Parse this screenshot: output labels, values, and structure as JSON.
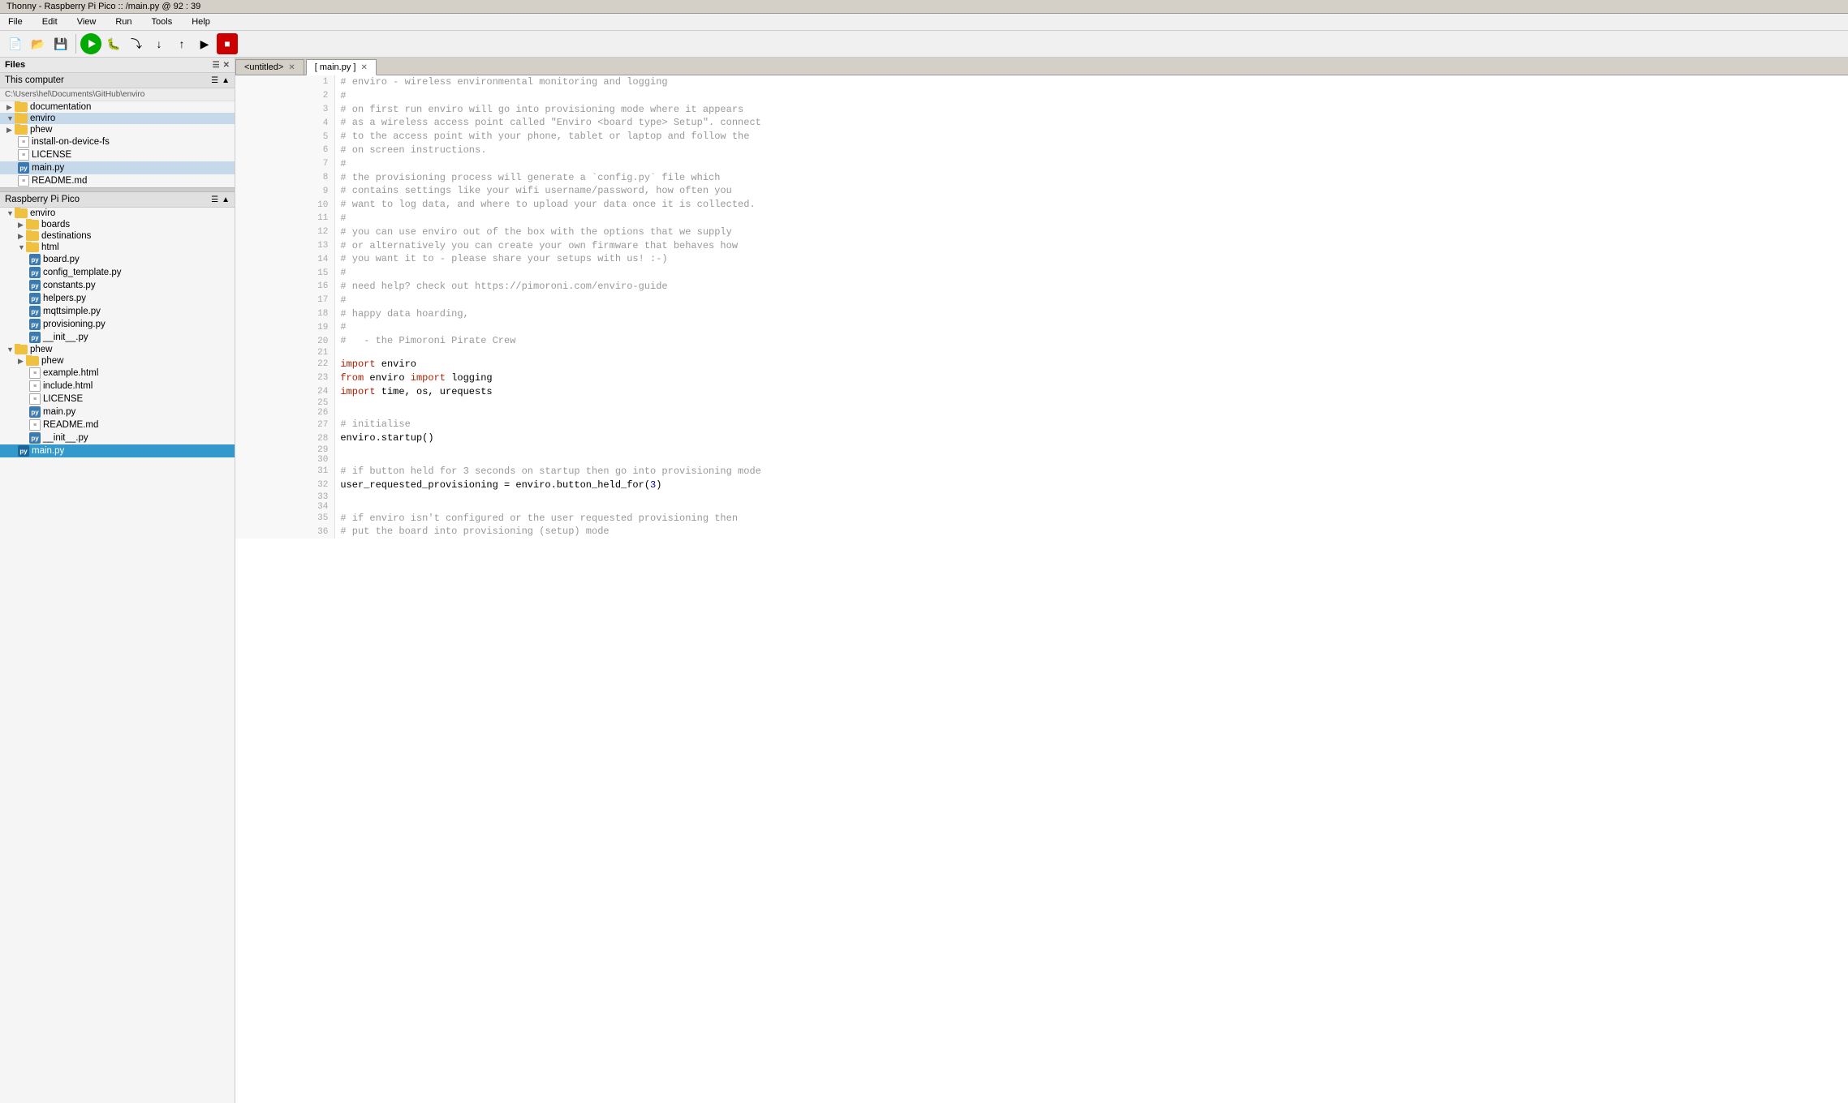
{
  "window": {
    "title": "Thonny - Raspberry Pi Pico :: /main.py @ 92 : 39"
  },
  "menu": {
    "items": [
      "File",
      "Edit",
      "View",
      "Run",
      "Tools",
      "Help"
    ]
  },
  "toolbar": {
    "buttons": [
      "new",
      "open",
      "save",
      "run",
      "debug",
      "step-over",
      "step-into",
      "step-out",
      "resume",
      "stop"
    ]
  },
  "files_panel": {
    "title": "Files",
    "this_computer": {
      "label": "This computer",
      "path": "C:\\Users\\hel\\Documents\\GitHub\\enviro"
    },
    "pi_pico": {
      "label": "Raspberry Pi Pico"
    }
  },
  "file_tree_computer": [
    {
      "name": "documentation",
      "type": "folder",
      "level": 0,
      "expanded": true
    },
    {
      "name": "enviro",
      "type": "folder",
      "level": 0,
      "expanded": true,
      "selected": true
    },
    {
      "name": "phew",
      "type": "folder",
      "level": 0,
      "expanded": false,
      "selected": false
    },
    {
      "name": "install-on-device-fs",
      "type": "text",
      "level": 0
    },
    {
      "name": "LICENSE",
      "type": "text",
      "level": 0
    },
    {
      "name": "main.py",
      "type": "python",
      "level": 0,
      "selected": true
    },
    {
      "name": "README.md",
      "type": "text",
      "level": 0
    }
  ],
  "file_tree_pico": [
    {
      "name": "enviro",
      "type": "folder",
      "level": 0,
      "expanded": true
    },
    {
      "name": "boards",
      "type": "folder",
      "level": 1,
      "expanded": false
    },
    {
      "name": "destinations",
      "type": "folder",
      "level": 1,
      "expanded": false
    },
    {
      "name": "html",
      "type": "folder",
      "level": 1,
      "expanded": true
    },
    {
      "name": "board.py",
      "type": "python",
      "level": 2
    },
    {
      "name": "config_template.py",
      "type": "python",
      "level": 2
    },
    {
      "name": "constants.py",
      "type": "python",
      "level": 2
    },
    {
      "name": "helpers.py",
      "type": "python",
      "level": 2
    },
    {
      "name": "mqttsimple.py",
      "type": "python",
      "level": 2
    },
    {
      "name": "provisioning.py",
      "type": "python",
      "level": 2
    },
    {
      "name": "__init__.py",
      "type": "python",
      "level": 2
    },
    {
      "name": "phew",
      "type": "folder",
      "level": 0,
      "expanded": true
    },
    {
      "name": "phew",
      "type": "folder",
      "level": 1,
      "expanded": false
    },
    {
      "name": "example.html",
      "type": "text",
      "level": 1
    },
    {
      "name": "include.html",
      "type": "text",
      "level": 1
    },
    {
      "name": "LICENSE",
      "type": "text",
      "level": 1
    },
    {
      "name": "main.py",
      "type": "python",
      "level": 1
    },
    {
      "name": "README.md",
      "type": "text",
      "level": 1
    },
    {
      "name": "__init__.py",
      "type": "python",
      "level": 1
    },
    {
      "name": "main.py",
      "type": "python",
      "level": 0,
      "selected_blue": true
    }
  ],
  "tabs": [
    {
      "label": "<untitled>",
      "active": false,
      "closable": true
    },
    {
      "label": "[ main.py ]",
      "active": true,
      "closable": true
    }
  ],
  "code_lines": [
    {
      "num": 1,
      "code": "# enviro - wireless environmental monitoring and logging",
      "type": "comment"
    },
    {
      "num": 2,
      "code": "#",
      "type": "comment"
    },
    {
      "num": 3,
      "code": "# on first run enviro will go into provisioning mode where it appears",
      "type": "comment"
    },
    {
      "num": 4,
      "code": "# as a wireless access point called \"Enviro <board type> Setup\". connect",
      "type": "comment"
    },
    {
      "num": 5,
      "code": "# to the access point with your phone, tablet or laptop and follow the",
      "type": "comment"
    },
    {
      "num": 6,
      "code": "# on screen instructions.",
      "type": "comment"
    },
    {
      "num": 7,
      "code": "#",
      "type": "comment"
    },
    {
      "num": 8,
      "code": "# the provisioning process will generate a `config.py` file which",
      "type": "comment"
    },
    {
      "num": 9,
      "code": "# contains settings like your wifi username/password, how often you",
      "type": "comment"
    },
    {
      "num": 10,
      "code": "# want to log data, and where to upload your data once it is collected.",
      "type": "comment"
    },
    {
      "num": 11,
      "code": "#",
      "type": "comment"
    },
    {
      "num": 12,
      "code": "# you can use enviro out of the box with the options that we supply",
      "type": "comment"
    },
    {
      "num": 13,
      "code": "# or alternatively you can create your own firmware that behaves how",
      "type": "comment"
    },
    {
      "num": 14,
      "code": "# you want it to - please share your setups with us! :-)",
      "type": "comment"
    },
    {
      "num": 15,
      "code": "#",
      "type": "comment"
    },
    {
      "num": 16,
      "code": "# need help? check out https://pimoroni.com/enviro-guide",
      "type": "comment"
    },
    {
      "num": 17,
      "code": "#",
      "type": "comment"
    },
    {
      "num": 18,
      "code": "# happy data hoarding,",
      "type": "comment"
    },
    {
      "num": 19,
      "code": "#",
      "type": "comment"
    },
    {
      "num": 20,
      "code": "#   - the Pimoroni Pirate Crew",
      "type": "comment"
    },
    {
      "num": 21,
      "code": "",
      "type": "normal"
    },
    {
      "num": 22,
      "code": "IMPORT enviro",
      "type": "import",
      "keyword": "import",
      "rest": " enviro"
    },
    {
      "num": 23,
      "code": "FROM enviro IMPORT logging",
      "type": "from_import",
      "kw1": "from",
      "mid": " enviro ",
      "kw2": "import",
      "rest": " logging"
    },
    {
      "num": 24,
      "code": "IMPORT time, os, urequests",
      "type": "import",
      "keyword": "import",
      "rest": " time, os, urequests"
    },
    {
      "num": 25,
      "code": "",
      "type": "normal"
    },
    {
      "num": 26,
      "code": "",
      "type": "normal"
    },
    {
      "num": 27,
      "code": "# initialise",
      "type": "comment"
    },
    {
      "num": 28,
      "code": "enviro.startup()",
      "type": "normal"
    },
    {
      "num": 29,
      "code": "",
      "type": "normal"
    },
    {
      "num": 30,
      "code": "",
      "type": "normal"
    },
    {
      "num": 31,
      "code": "# if button held for 3 seconds on startup then go into provisioning mode",
      "type": "comment"
    },
    {
      "num": 32,
      "code": "user_requested_provisioning = enviro.button_held_for(3)",
      "type": "normal",
      "has_number": true,
      "number": "3"
    },
    {
      "num": 33,
      "code": "",
      "type": "normal"
    },
    {
      "num": 34,
      "code": "",
      "type": "normal"
    },
    {
      "num": 35,
      "code": "# if enviro isn't configured or the user requested provisioning then",
      "type": "comment"
    },
    {
      "num": 36,
      "code": "# put the board into provisioning (setup) mode",
      "type": "comment"
    }
  ]
}
